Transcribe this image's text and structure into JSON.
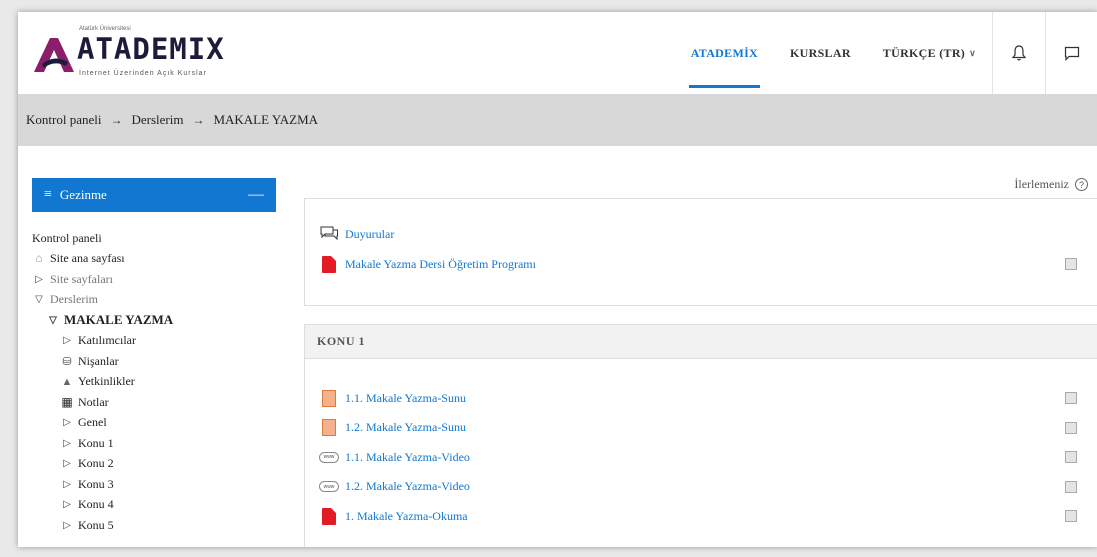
{
  "logo": {
    "top_text": "Atatürk Üniversitesi",
    "main_text": "ATADEMIX",
    "sub_text": "İnternet Üzerinden Açık Kurslar",
    "brand_color": "#8b1e6b"
  },
  "nav": {
    "items": [
      {
        "label": "ATADEMİX",
        "active": true
      },
      {
        "label": "KURSLAR",
        "active": false
      },
      {
        "label": "TÜRKÇE (TR)",
        "active": false
      }
    ],
    "accent_color": "#1177d1",
    "icons": [
      "bell-icon",
      "chat-icon"
    ]
  },
  "breadcrumb": {
    "items": [
      "Kontrol paneli",
      "Derslerim",
      "MAKALE YAZMA"
    ],
    "separator": "→"
  },
  "sidebar": {
    "title": "Gezinme",
    "tree": [
      {
        "label": "Kontrol paneli",
        "icon": "",
        "indent": 0,
        "style": "normal"
      },
      {
        "label": "Site ana sayfası",
        "icon": "home-icon",
        "indent": 0,
        "style": "normal"
      },
      {
        "label": "Site sayfaları",
        "icon": "triangle-right-icon",
        "indent": 0,
        "style": "muted"
      },
      {
        "label": "Derslerim",
        "icon": "triangle-down-icon",
        "indent": 0,
        "style": "muted"
      },
      {
        "label": "MAKALE YAZMA",
        "icon": "triangle-down-icon",
        "indent": 1,
        "style": "bold"
      },
      {
        "label": "Katılımcılar",
        "icon": "triangle-right-icon",
        "indent": 2,
        "style": "normal"
      },
      {
        "label": "Nişanlar",
        "icon": "trophy-icon",
        "indent": 2,
        "style": "normal"
      },
      {
        "label": "Yetkinlikler",
        "icon": "competency-icon",
        "indent": 2,
        "style": "normal"
      },
      {
        "label": "Notlar",
        "icon": "grid-icon",
        "indent": 2,
        "style": "normal"
      },
      {
        "label": "Genel",
        "icon": "triangle-right-icon",
        "indent": 2,
        "style": "normal"
      },
      {
        "label": "Konu 1",
        "icon": "triangle-right-icon",
        "indent": 2,
        "style": "normal"
      },
      {
        "label": "Konu 2",
        "icon": "triangle-right-icon",
        "indent": 2,
        "style": "normal"
      },
      {
        "label": "Konu 3",
        "icon": "triangle-right-icon",
        "indent": 2,
        "style": "normal"
      },
      {
        "label": "Konu 4",
        "icon": "triangle-right-icon",
        "indent": 2,
        "style": "normal"
      },
      {
        "label": "Konu 5",
        "icon": "triangle-right-icon",
        "indent": 2,
        "style": "normal"
      }
    ]
  },
  "main": {
    "progress_label": "İlerlemeniz",
    "general_section": {
      "activities": [
        {
          "label": "Duyurular",
          "icon": "forum-icon",
          "has_checkbox": false
        },
        {
          "label": "Makale Yazma Dersi Öğretim Programı",
          "icon": "pdf-icon",
          "has_checkbox": true
        }
      ]
    },
    "section1": {
      "title": "KONU 1",
      "activities": [
        {
          "label": "1.1. Makale Yazma-Sunu",
          "icon": "ppt-icon",
          "has_checkbox": true
        },
        {
          "label": "1.2. Makale Yazma-Sunu",
          "icon": "ppt-icon",
          "has_checkbox": true
        },
        {
          "label": "1.1. Makale Yazma-Video",
          "icon": "url-icon",
          "has_checkbox": true
        },
        {
          "label": "1.2. Makale Yazma-Video",
          "icon": "url-icon",
          "has_checkbox": true
        },
        {
          "label": "1. Makale Yazma-Okuma",
          "icon": "pdf-icon",
          "has_checkbox": true
        }
      ]
    }
  }
}
